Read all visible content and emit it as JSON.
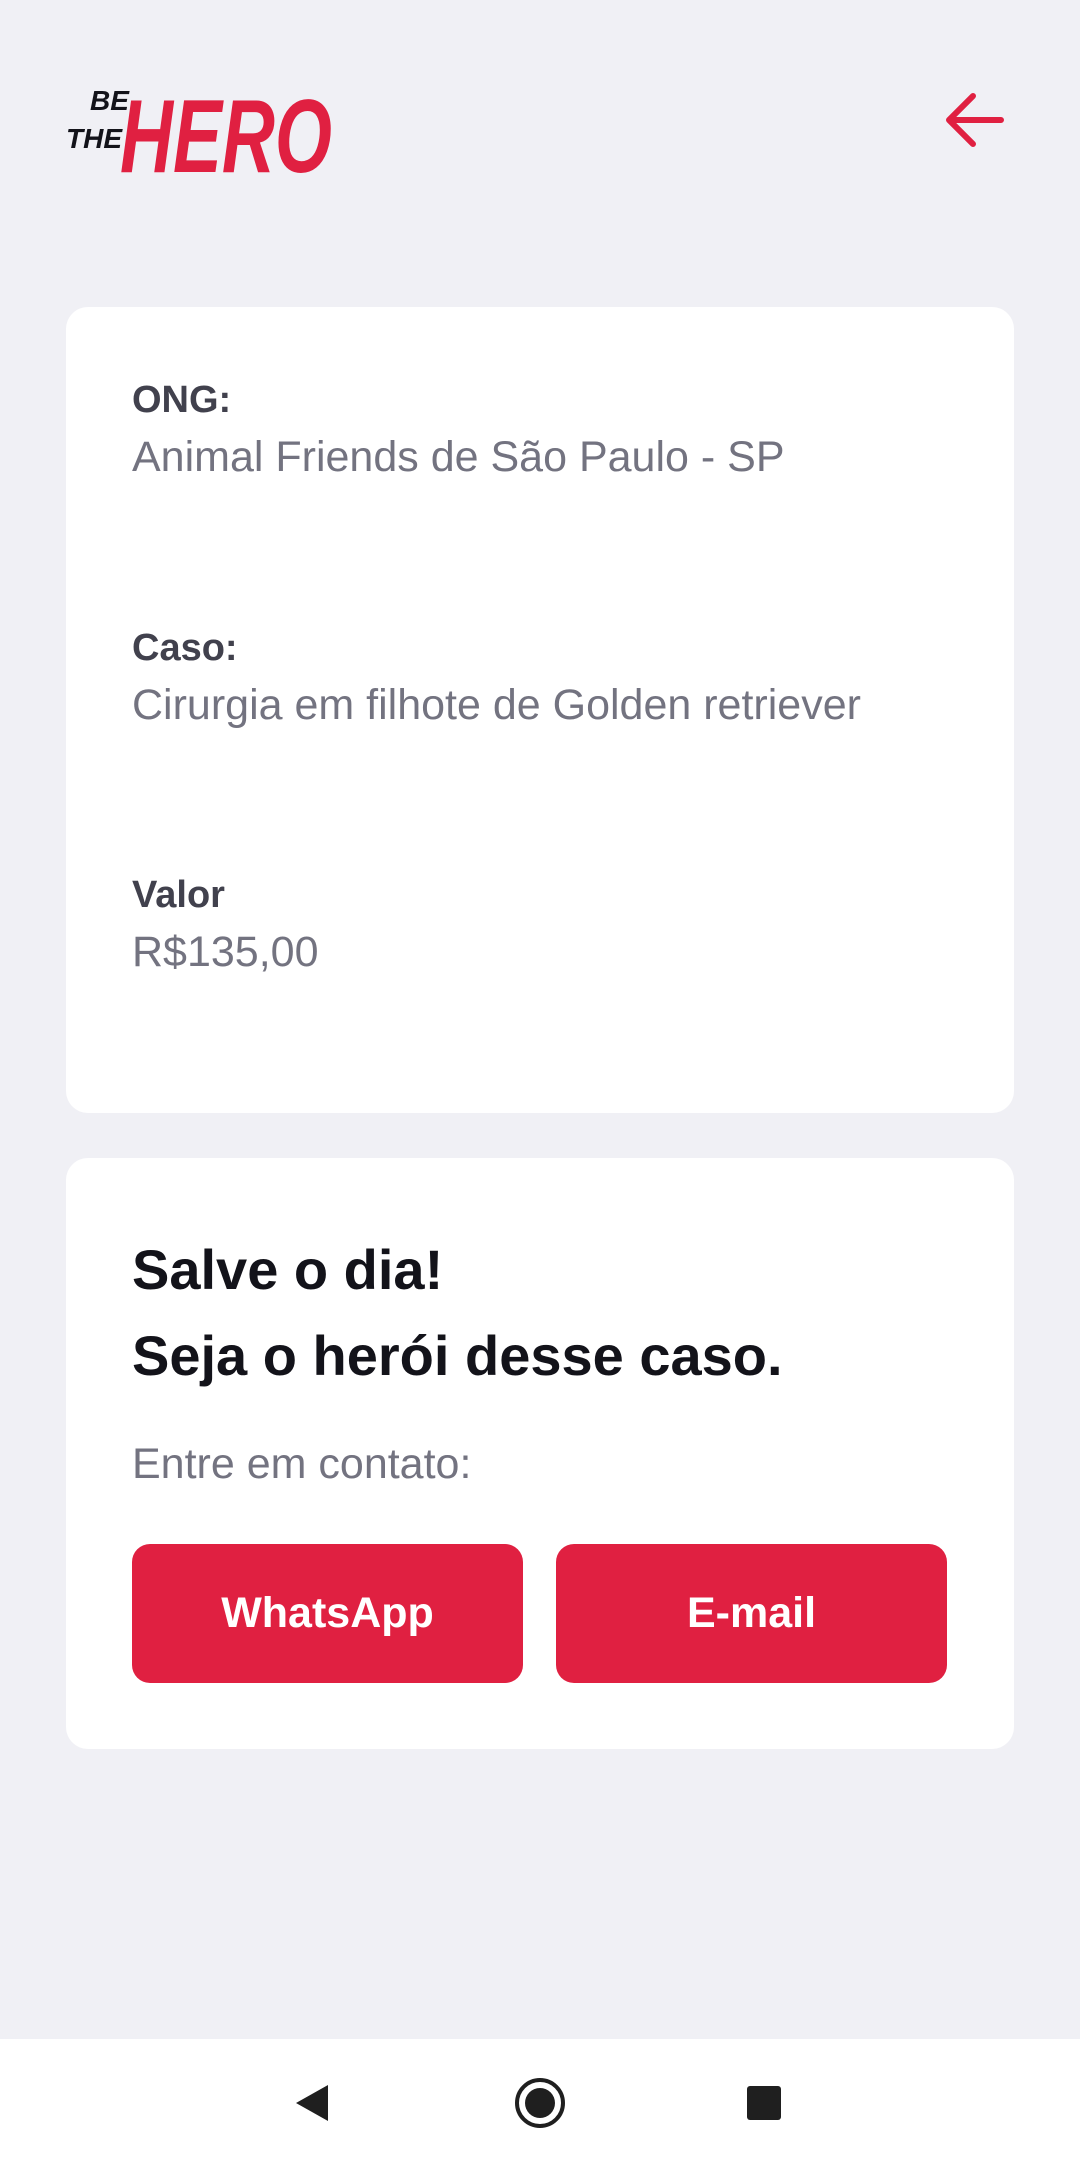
{
  "colors": {
    "accent": "#e02041",
    "background": "#f0f0f5",
    "card": "#ffffff"
  },
  "header": {
    "logo_text_small_top": "BE",
    "logo_text_small_bottom": "THE",
    "logo_text_large": "HERO",
    "back_icon": "arrow-left-icon"
  },
  "incident": {
    "ong_label": "ONG:",
    "ong_value": "Animal Friends de São Paulo - SP",
    "case_label": "Caso:",
    "case_value": "Cirurgia em filhote de Golden retriever",
    "value_label": "Valor",
    "value_value": "R$135,00"
  },
  "contact": {
    "title_line1": "Salve o dia!",
    "title_line2": "Seja o herói desse caso.",
    "description": "Entre em contato:",
    "whatsapp_label": "WhatsApp",
    "email_label": "E-mail"
  },
  "navbar": {
    "back_icon": "nav-back-icon",
    "home_icon": "nav-home-icon",
    "recents_icon": "nav-recents-icon"
  }
}
